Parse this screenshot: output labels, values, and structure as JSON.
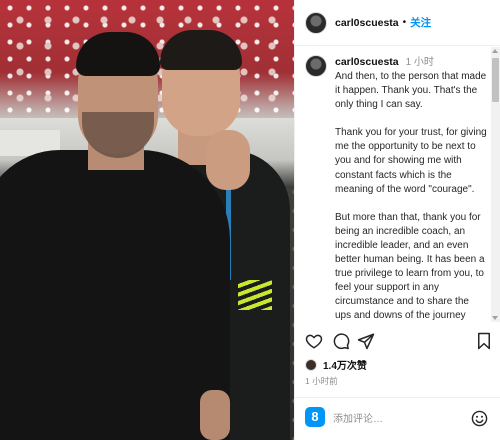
{
  "header": {
    "username": "carl0scuesta",
    "separator": "•",
    "follow_label": "关注"
  },
  "caption": {
    "username": "carl0scuesta",
    "time": "1 小时",
    "paragraphs": [
      "And then, to the person that made it happen. Thank you. That's the only thing I can say.",
      "Thank you for your trust, for giving me the opportunity to be next to you and for showing me with constant facts which is the meaning of the word \"courage\".",
      "But more than that, thank you for being an incredible coach, an incredible leader, and an even better human being. It has been a true privilege to learn from you, to feel your support in any circumstance and to share the ups and downs of the journey always seeing the positive side of it. You've taught me"
    ]
  },
  "actions": {
    "icons": [
      "heart-icon",
      "comment-icon",
      "share-icon",
      "bookmark-icon"
    ]
  },
  "likes": "1.4万次赞",
  "posted_time": "1 小时前",
  "comment": {
    "placeholder": "添加评论…",
    "threads_glyph": "8"
  },
  "colors": {
    "accent": "#0095f6",
    "text": "#262626",
    "muted": "#8e8e8e"
  }
}
